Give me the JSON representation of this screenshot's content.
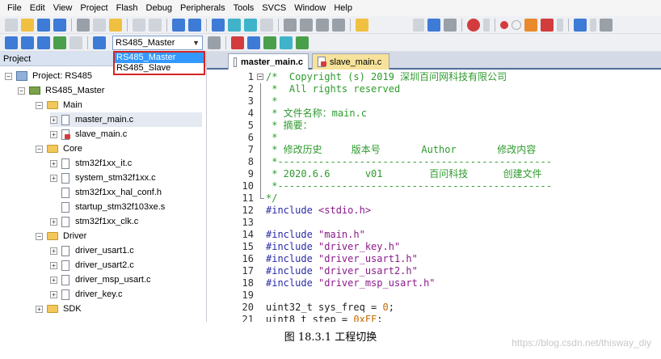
{
  "menubar": [
    "File",
    "Edit",
    "View",
    "Project",
    "Flash",
    "Debug",
    "Peripherals",
    "Tools",
    "SVCS",
    "Window",
    "Help"
  ],
  "target_select": {
    "value": "RS485_Master",
    "options": [
      "RS485_Master",
      "RS485_Slave"
    ],
    "selected_index": 0
  },
  "project_panel": {
    "header": "Project",
    "tree": [
      {
        "label": "Project: RS485",
        "level": 0,
        "type": "project",
        "expander": "−"
      },
      {
        "label": "RS485_Master",
        "level": 1,
        "type": "target",
        "expander": "−"
      },
      {
        "label": "Main",
        "level": 2,
        "type": "folder",
        "expander": "−"
      },
      {
        "label": "master_main.c",
        "level": 3,
        "type": "file",
        "expander": "+"
      },
      {
        "label": "slave_main.c",
        "level": 3,
        "type": "file-locked",
        "expander": "+"
      },
      {
        "label": "Core",
        "level": 2,
        "type": "folder",
        "expander": "−"
      },
      {
        "label": "stm32f1xx_it.c",
        "level": 3,
        "type": "file",
        "expander": "+"
      },
      {
        "label": "system_stm32f1xx.c",
        "level": 3,
        "type": "file",
        "expander": "+"
      },
      {
        "label": "stm32f1xx_hal_conf.h",
        "level": 3,
        "type": "file",
        "expander": ""
      },
      {
        "label": "startup_stm32f103xe.s",
        "level": 3,
        "type": "file",
        "expander": ""
      },
      {
        "label": "stm32f1xx_clk.c",
        "level": 3,
        "type": "file",
        "expander": "+"
      },
      {
        "label": "Driver",
        "level": 2,
        "type": "folder",
        "expander": "−"
      },
      {
        "label": "driver_usart1.c",
        "level": 3,
        "type": "file",
        "expander": "+"
      },
      {
        "label": "driver_usart2.c",
        "level": 3,
        "type": "file",
        "expander": "+"
      },
      {
        "label": "driver_msp_usart.c",
        "level": 3,
        "type": "file",
        "expander": "+"
      },
      {
        "label": "driver_key.c",
        "level": 3,
        "type": "file",
        "expander": "+"
      },
      {
        "label": "SDK",
        "level": 2,
        "type": "folder",
        "expander": "+"
      }
    ]
  },
  "editor_tabs": [
    {
      "label": "master_main.c",
      "active": true
    },
    {
      "label": "slave_main.c",
      "active": false
    }
  ],
  "code_lines": [
    {
      "n": "1",
      "fold": "−",
      "segs": [
        {
          "c": "cm",
          "t": "/*  Copyright (s) 2019 深圳百问网科技有限公司"
        }
      ]
    },
    {
      "n": "2",
      "fold": "",
      "segs": [
        {
          "c": "cm",
          "t": " *  All rights reserved"
        }
      ]
    },
    {
      "n": "3",
      "fold": "",
      "segs": [
        {
          "c": "cm",
          "t": " *"
        }
      ]
    },
    {
      "n": "4",
      "fold": "",
      "segs": [
        {
          "c": "cm",
          "t": " * 文件名称：main.c"
        }
      ]
    },
    {
      "n": "5",
      "fold": "",
      "segs": [
        {
          "c": "cm",
          "t": " * 摘要："
        }
      ]
    },
    {
      "n": "6",
      "fold": "",
      "segs": [
        {
          "c": "cm",
          "t": " *"
        }
      ]
    },
    {
      "n": "7",
      "fold": "",
      "segs": [
        {
          "c": "cm",
          "t": " * 修改历史     版本号       Author       修改内容"
        }
      ]
    },
    {
      "n": "8",
      "fold": "",
      "segs": [
        {
          "c": "cm",
          "t": " *-----------------------------------------------"
        }
      ]
    },
    {
      "n": "9",
      "fold": "",
      "segs": [
        {
          "c": "cm",
          "t": " * 2020.6.6      v01        百问科技      创建文件"
        }
      ]
    },
    {
      "n": "10",
      "fold": "",
      "segs": [
        {
          "c": "cm",
          "t": " *-----------------------------------------------"
        }
      ]
    },
    {
      "n": "11",
      "fold": "end",
      "segs": [
        {
          "c": "cm",
          "t": "*/"
        }
      ]
    },
    {
      "n": "12",
      "fold": "",
      "segs": [
        {
          "c": "pp",
          "t": "#include "
        },
        {
          "c": "str",
          "t": "<stdio.h>"
        }
      ]
    },
    {
      "n": "13",
      "fold": "",
      "segs": []
    },
    {
      "n": "14",
      "fold": "",
      "segs": [
        {
          "c": "pp",
          "t": "#include "
        },
        {
          "c": "str",
          "t": "\"main.h\""
        }
      ]
    },
    {
      "n": "15",
      "fold": "",
      "segs": [
        {
          "c": "pp",
          "t": "#include "
        },
        {
          "c": "str",
          "t": "\"driver_key.h\""
        }
      ]
    },
    {
      "n": "16",
      "fold": "",
      "segs": [
        {
          "c": "pp",
          "t": "#include "
        },
        {
          "c": "str",
          "t": "\"driver_usart1.h\""
        }
      ]
    },
    {
      "n": "17",
      "fold": "",
      "segs": [
        {
          "c": "pp",
          "t": "#include "
        },
        {
          "c": "str",
          "t": "\"driver_usart2.h\""
        }
      ]
    },
    {
      "n": "18",
      "fold": "",
      "segs": [
        {
          "c": "pp",
          "t": "#include "
        },
        {
          "c": "str",
          "t": "\"driver_msp_usart.h\""
        }
      ]
    },
    {
      "n": "19",
      "fold": "",
      "segs": []
    },
    {
      "n": "20",
      "fold": "",
      "segs": [
        {
          "c": "kw",
          "t": "uint32_t sys_freq = "
        },
        {
          "c": "num",
          "t": "0"
        },
        {
          "c": "kw",
          "t": ";"
        }
      ]
    },
    {
      "n": "21",
      "fold": "",
      "segs": [
        {
          "c": "kw",
          "t": "uint8_t step = "
        },
        {
          "c": "num",
          "t": "0xFF"
        },
        {
          "c": "kw",
          "t": ";"
        }
      ]
    }
  ],
  "caption": "图 18.3.1 工程切换",
  "watermark": "https://blog.csdn.net/thisway_diy",
  "colors": {
    "comment": "#2e9a2e",
    "preprocessor": "#2a2aa8",
    "string": "#8a1a8a",
    "dropdown_border": "#d62424",
    "selection": "#3399ff"
  }
}
